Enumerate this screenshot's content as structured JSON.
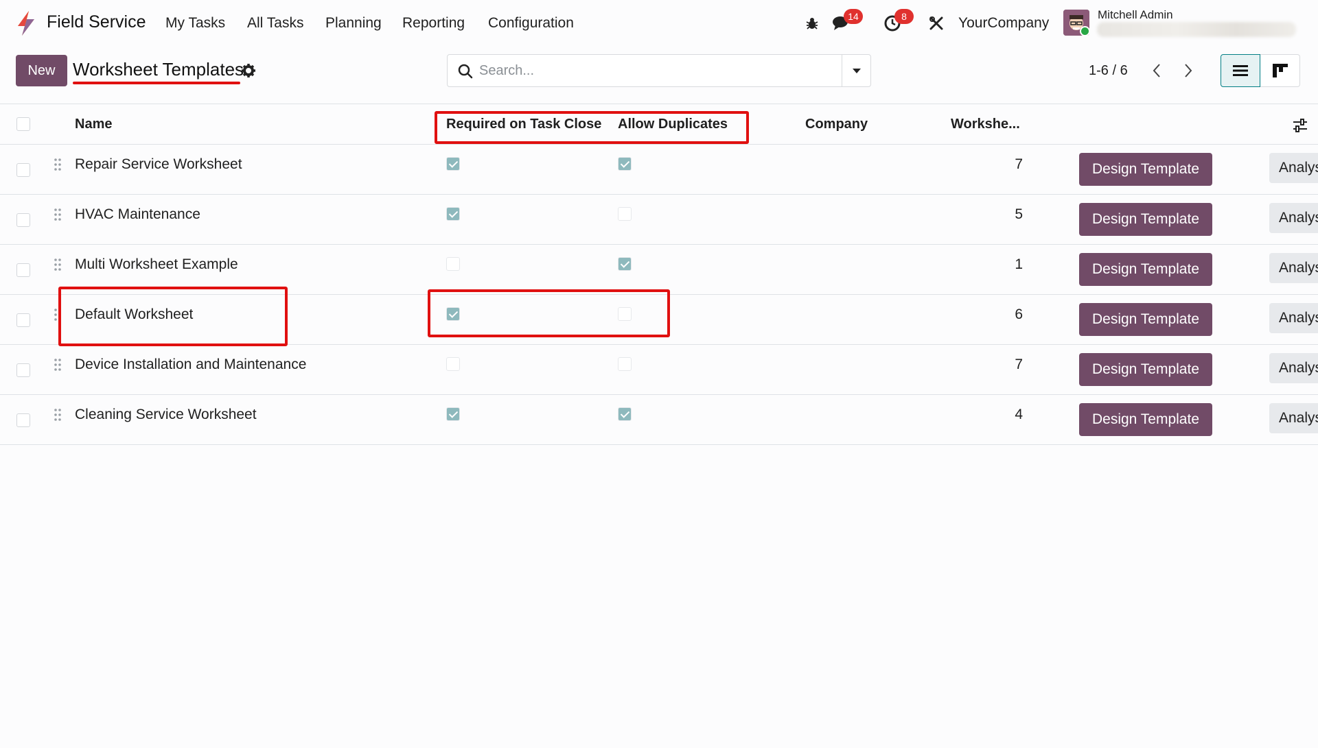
{
  "app": {
    "name": "Field Service",
    "menu": [
      "My Tasks",
      "All Tasks",
      "Planning",
      "Reporting",
      "Configuration"
    ],
    "brand_colors": {
      "primary": "#714b67",
      "annotation": "#e01010",
      "checkbox": "#8eb9bd"
    }
  },
  "systray": {
    "messages_count": "14",
    "activities_count": "8",
    "company": "YourCompany",
    "user_name": "Mitchell Admin",
    "icons": [
      "bug-icon",
      "chat-icon",
      "clock-icon",
      "tools-icon"
    ]
  },
  "control_panel": {
    "new_label": "New",
    "title": "Worksheet Templates",
    "search_placeholder": "Search...",
    "pager": "1-6 / 6"
  },
  "table": {
    "headers": {
      "name": "Name",
      "required": "Required on Task Close",
      "duplicates": "Allow Duplicates",
      "company": "Company",
      "worksheets": "Workshe..."
    },
    "rows": [
      {
        "name": "Repair Service Worksheet",
        "required": true,
        "duplicates": true,
        "count": "7",
        "design_label": "Design Template",
        "analysis_label": "Analysis"
      },
      {
        "name": "HVAC Maintenance",
        "required": true,
        "duplicates": false,
        "count": "5",
        "design_label": "Design Template",
        "analysis_label": "Analysis"
      },
      {
        "name": "Multi Worksheet Example",
        "required": false,
        "duplicates": true,
        "count": "1",
        "design_label": "Design Template",
        "analysis_label": "Analysis"
      },
      {
        "name": "Default Worksheet",
        "required": true,
        "duplicates": false,
        "count": "6",
        "design_label": "Design Template",
        "analysis_label": "Analysis"
      },
      {
        "name": "Device Installation and Maintenance",
        "required": false,
        "duplicates": false,
        "count": "7",
        "design_label": "Design Template",
        "analysis_label": "Analysis"
      },
      {
        "name": "Cleaning Service Worksheet",
        "required": true,
        "duplicates": true,
        "count": "4",
        "design_label": "Design Template",
        "analysis_label": "Analysis"
      }
    ]
  }
}
